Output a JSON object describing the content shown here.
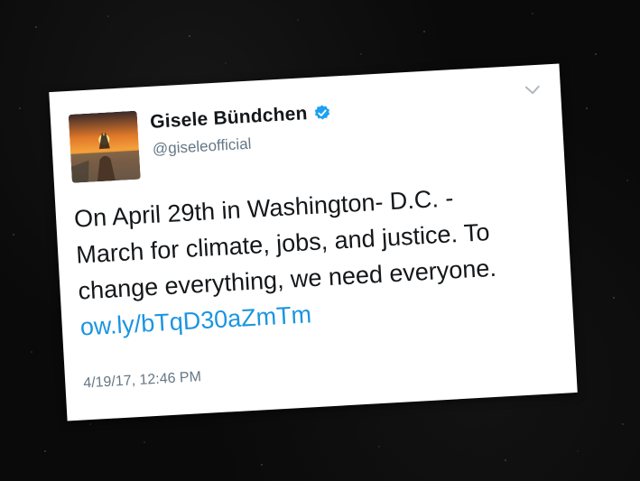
{
  "tweet": {
    "display_name": "Gisele Bündchen",
    "handle": "@giseleofficial",
    "verified_icon": "verified-badge-icon",
    "text_lines": [
      "On April 29th in Washington- D.C. -",
      "March for climate, jobs, and justice. To",
      "change everything, we need everyone."
    ],
    "link": "ow.ly/bTqD30aZmTm",
    "timestamp": "4/19/17, 12:46 PM"
  },
  "colors": {
    "background": "#0a0a0a",
    "card": "#ffffff",
    "name": "#14171a",
    "secondary": "#657786",
    "link": "#1b95e0",
    "verified": "#1da1f2"
  }
}
